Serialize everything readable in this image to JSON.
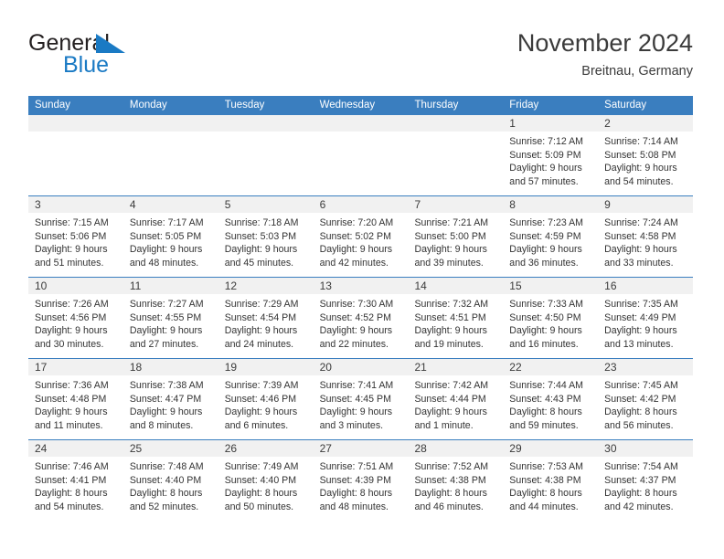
{
  "brand": {
    "line1": "General",
    "line2": "Blue",
    "triangle_color": "#1a7ac4",
    "text_color": "#231f20"
  },
  "header": {
    "month_title": "November 2024",
    "location": "Breitnau, Germany"
  },
  "colors": {
    "header_bg": "#3a7ebf",
    "header_text": "#ffffff",
    "daynum_band": "#f1f1f1",
    "row_border": "#3a7ebf",
    "body_text": "#333333"
  },
  "calendar": {
    "weekday_headers": [
      "Sunday",
      "Monday",
      "Tuesday",
      "Wednesday",
      "Thursday",
      "Friday",
      "Saturday"
    ],
    "weeks": [
      [
        {
          "day": "",
          "text": ""
        },
        {
          "day": "",
          "text": ""
        },
        {
          "day": "",
          "text": ""
        },
        {
          "day": "",
          "text": ""
        },
        {
          "day": "",
          "text": ""
        },
        {
          "day": "1",
          "text": "Sunrise: 7:12 AM\nSunset: 5:09 PM\nDaylight: 9 hours\nand 57 minutes."
        },
        {
          "day": "2",
          "text": "Sunrise: 7:14 AM\nSunset: 5:08 PM\nDaylight: 9 hours\nand 54 minutes."
        }
      ],
      [
        {
          "day": "3",
          "text": "Sunrise: 7:15 AM\nSunset: 5:06 PM\nDaylight: 9 hours\nand 51 minutes."
        },
        {
          "day": "4",
          "text": "Sunrise: 7:17 AM\nSunset: 5:05 PM\nDaylight: 9 hours\nand 48 minutes."
        },
        {
          "day": "5",
          "text": "Sunrise: 7:18 AM\nSunset: 5:03 PM\nDaylight: 9 hours\nand 45 minutes."
        },
        {
          "day": "6",
          "text": "Sunrise: 7:20 AM\nSunset: 5:02 PM\nDaylight: 9 hours\nand 42 minutes."
        },
        {
          "day": "7",
          "text": "Sunrise: 7:21 AM\nSunset: 5:00 PM\nDaylight: 9 hours\nand 39 minutes."
        },
        {
          "day": "8",
          "text": "Sunrise: 7:23 AM\nSunset: 4:59 PM\nDaylight: 9 hours\nand 36 minutes."
        },
        {
          "day": "9",
          "text": "Sunrise: 7:24 AM\nSunset: 4:58 PM\nDaylight: 9 hours\nand 33 minutes."
        }
      ],
      [
        {
          "day": "10",
          "text": "Sunrise: 7:26 AM\nSunset: 4:56 PM\nDaylight: 9 hours\nand 30 minutes."
        },
        {
          "day": "11",
          "text": "Sunrise: 7:27 AM\nSunset: 4:55 PM\nDaylight: 9 hours\nand 27 minutes."
        },
        {
          "day": "12",
          "text": "Sunrise: 7:29 AM\nSunset: 4:54 PM\nDaylight: 9 hours\nand 24 minutes."
        },
        {
          "day": "13",
          "text": "Sunrise: 7:30 AM\nSunset: 4:52 PM\nDaylight: 9 hours\nand 22 minutes."
        },
        {
          "day": "14",
          "text": "Sunrise: 7:32 AM\nSunset: 4:51 PM\nDaylight: 9 hours\nand 19 minutes."
        },
        {
          "day": "15",
          "text": "Sunrise: 7:33 AM\nSunset: 4:50 PM\nDaylight: 9 hours\nand 16 minutes."
        },
        {
          "day": "16",
          "text": "Sunrise: 7:35 AM\nSunset: 4:49 PM\nDaylight: 9 hours\nand 13 minutes."
        }
      ],
      [
        {
          "day": "17",
          "text": "Sunrise: 7:36 AM\nSunset: 4:48 PM\nDaylight: 9 hours\nand 11 minutes."
        },
        {
          "day": "18",
          "text": "Sunrise: 7:38 AM\nSunset: 4:47 PM\nDaylight: 9 hours\nand 8 minutes."
        },
        {
          "day": "19",
          "text": "Sunrise: 7:39 AM\nSunset: 4:46 PM\nDaylight: 9 hours\nand 6 minutes."
        },
        {
          "day": "20",
          "text": "Sunrise: 7:41 AM\nSunset: 4:45 PM\nDaylight: 9 hours\nand 3 minutes."
        },
        {
          "day": "21",
          "text": "Sunrise: 7:42 AM\nSunset: 4:44 PM\nDaylight: 9 hours\nand 1 minute."
        },
        {
          "day": "22",
          "text": "Sunrise: 7:44 AM\nSunset: 4:43 PM\nDaylight: 8 hours\nand 59 minutes."
        },
        {
          "day": "23",
          "text": "Sunrise: 7:45 AM\nSunset: 4:42 PM\nDaylight: 8 hours\nand 56 minutes."
        }
      ],
      [
        {
          "day": "24",
          "text": "Sunrise: 7:46 AM\nSunset: 4:41 PM\nDaylight: 8 hours\nand 54 minutes."
        },
        {
          "day": "25",
          "text": "Sunrise: 7:48 AM\nSunset: 4:40 PM\nDaylight: 8 hours\nand 52 minutes."
        },
        {
          "day": "26",
          "text": "Sunrise: 7:49 AM\nSunset: 4:40 PM\nDaylight: 8 hours\nand 50 minutes."
        },
        {
          "day": "27",
          "text": "Sunrise: 7:51 AM\nSunset: 4:39 PM\nDaylight: 8 hours\nand 48 minutes."
        },
        {
          "day": "28",
          "text": "Sunrise: 7:52 AM\nSunset: 4:38 PM\nDaylight: 8 hours\nand 46 minutes."
        },
        {
          "day": "29",
          "text": "Sunrise: 7:53 AM\nSunset: 4:38 PM\nDaylight: 8 hours\nand 44 minutes."
        },
        {
          "day": "30",
          "text": "Sunrise: 7:54 AM\nSunset: 4:37 PM\nDaylight: 8 hours\nand 42 minutes."
        }
      ]
    ]
  }
}
